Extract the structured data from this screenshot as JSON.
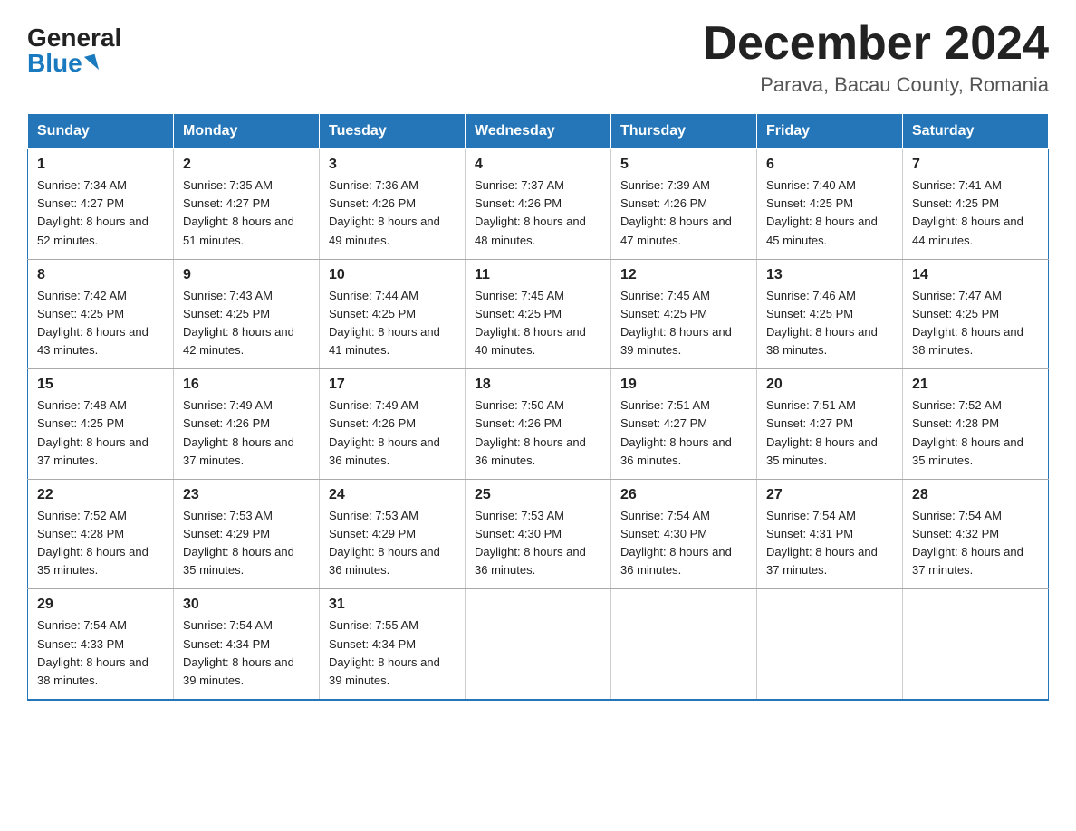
{
  "header": {
    "logo_general": "General",
    "logo_blue": "Blue",
    "month_year": "December 2024",
    "location": "Parava, Bacau County, Romania"
  },
  "days_of_week": [
    "Sunday",
    "Monday",
    "Tuesday",
    "Wednesday",
    "Thursday",
    "Friday",
    "Saturday"
  ],
  "weeks": [
    [
      {
        "day": "1",
        "sunrise": "7:34 AM",
        "sunset": "4:27 PM",
        "daylight": "8 hours and 52 minutes."
      },
      {
        "day": "2",
        "sunrise": "7:35 AM",
        "sunset": "4:27 PM",
        "daylight": "8 hours and 51 minutes."
      },
      {
        "day": "3",
        "sunrise": "7:36 AM",
        "sunset": "4:26 PM",
        "daylight": "8 hours and 49 minutes."
      },
      {
        "day": "4",
        "sunrise": "7:37 AM",
        "sunset": "4:26 PM",
        "daylight": "8 hours and 48 minutes."
      },
      {
        "day": "5",
        "sunrise": "7:39 AM",
        "sunset": "4:26 PM",
        "daylight": "8 hours and 47 minutes."
      },
      {
        "day": "6",
        "sunrise": "7:40 AM",
        "sunset": "4:25 PM",
        "daylight": "8 hours and 45 minutes."
      },
      {
        "day": "7",
        "sunrise": "7:41 AM",
        "sunset": "4:25 PM",
        "daylight": "8 hours and 44 minutes."
      }
    ],
    [
      {
        "day": "8",
        "sunrise": "7:42 AM",
        "sunset": "4:25 PM",
        "daylight": "8 hours and 43 minutes."
      },
      {
        "day": "9",
        "sunrise": "7:43 AM",
        "sunset": "4:25 PM",
        "daylight": "8 hours and 42 minutes."
      },
      {
        "day": "10",
        "sunrise": "7:44 AM",
        "sunset": "4:25 PM",
        "daylight": "8 hours and 41 minutes."
      },
      {
        "day": "11",
        "sunrise": "7:45 AM",
        "sunset": "4:25 PM",
        "daylight": "8 hours and 40 minutes."
      },
      {
        "day": "12",
        "sunrise": "7:45 AM",
        "sunset": "4:25 PM",
        "daylight": "8 hours and 39 minutes."
      },
      {
        "day": "13",
        "sunrise": "7:46 AM",
        "sunset": "4:25 PM",
        "daylight": "8 hours and 38 minutes."
      },
      {
        "day": "14",
        "sunrise": "7:47 AM",
        "sunset": "4:25 PM",
        "daylight": "8 hours and 38 minutes."
      }
    ],
    [
      {
        "day": "15",
        "sunrise": "7:48 AM",
        "sunset": "4:25 PM",
        "daylight": "8 hours and 37 minutes."
      },
      {
        "day": "16",
        "sunrise": "7:49 AM",
        "sunset": "4:26 PM",
        "daylight": "8 hours and 37 minutes."
      },
      {
        "day": "17",
        "sunrise": "7:49 AM",
        "sunset": "4:26 PM",
        "daylight": "8 hours and 36 minutes."
      },
      {
        "day": "18",
        "sunrise": "7:50 AM",
        "sunset": "4:26 PM",
        "daylight": "8 hours and 36 minutes."
      },
      {
        "day": "19",
        "sunrise": "7:51 AM",
        "sunset": "4:27 PM",
        "daylight": "8 hours and 36 minutes."
      },
      {
        "day": "20",
        "sunrise": "7:51 AM",
        "sunset": "4:27 PM",
        "daylight": "8 hours and 35 minutes."
      },
      {
        "day": "21",
        "sunrise": "7:52 AM",
        "sunset": "4:28 PM",
        "daylight": "8 hours and 35 minutes."
      }
    ],
    [
      {
        "day": "22",
        "sunrise": "7:52 AM",
        "sunset": "4:28 PM",
        "daylight": "8 hours and 35 minutes."
      },
      {
        "day": "23",
        "sunrise": "7:53 AM",
        "sunset": "4:29 PM",
        "daylight": "8 hours and 35 minutes."
      },
      {
        "day": "24",
        "sunrise": "7:53 AM",
        "sunset": "4:29 PM",
        "daylight": "8 hours and 36 minutes."
      },
      {
        "day": "25",
        "sunrise": "7:53 AM",
        "sunset": "4:30 PM",
        "daylight": "8 hours and 36 minutes."
      },
      {
        "day": "26",
        "sunrise": "7:54 AM",
        "sunset": "4:30 PM",
        "daylight": "8 hours and 36 minutes."
      },
      {
        "day": "27",
        "sunrise": "7:54 AM",
        "sunset": "4:31 PM",
        "daylight": "8 hours and 37 minutes."
      },
      {
        "day": "28",
        "sunrise": "7:54 AM",
        "sunset": "4:32 PM",
        "daylight": "8 hours and 37 minutes."
      }
    ],
    [
      {
        "day": "29",
        "sunrise": "7:54 AM",
        "sunset": "4:33 PM",
        "daylight": "8 hours and 38 minutes."
      },
      {
        "day": "30",
        "sunrise": "7:54 AM",
        "sunset": "4:34 PM",
        "daylight": "8 hours and 39 minutes."
      },
      {
        "day": "31",
        "sunrise": "7:55 AM",
        "sunset": "4:34 PM",
        "daylight": "8 hours and 39 minutes."
      },
      null,
      null,
      null,
      null
    ]
  ],
  "labels": {
    "sunrise_prefix": "Sunrise: ",
    "sunset_prefix": "Sunset: ",
    "daylight_prefix": "Daylight: "
  }
}
